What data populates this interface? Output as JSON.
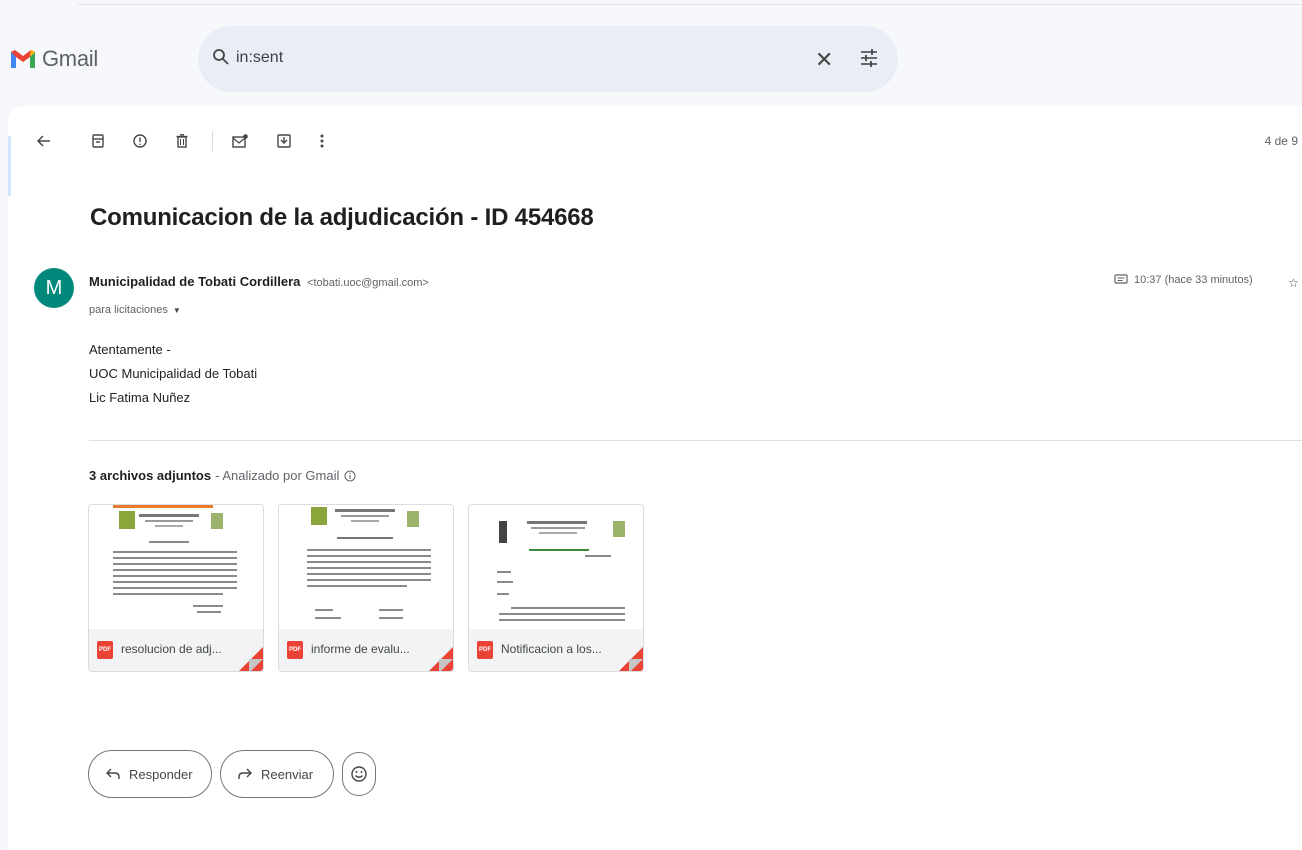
{
  "app": {
    "name": "Gmail"
  },
  "search": {
    "value": "in:sent"
  },
  "toolbar": {
    "page_count": "4 de 9"
  },
  "email": {
    "subject": "Comunicacion de la adjudicación - ID 454668",
    "avatar_letter": "M",
    "sender_name": "Municipalidad de Tobati Cordillera",
    "sender_email": "<tobati.uoc@gmail.com>",
    "recipient": "para licitaciones",
    "time": "10:37 (hace 33 minutos)",
    "body_lines": [
      "Atentamente -",
      "UOC Municipalidad de Tobati",
      "Lic Fatima Nuñez"
    ]
  },
  "attachments": {
    "count_label": "3 archivos adjuntos",
    "scan_label": "- Analizado por Gmail",
    "files": [
      {
        "name": "resolucion de adj...",
        "type": "PDF"
      },
      {
        "name": "informe de evalu...",
        "type": "PDF"
      },
      {
        "name": "Notificacion a los...",
        "type": "PDF"
      }
    ]
  },
  "actions": {
    "reply": "Responder",
    "forward": "Reenviar"
  },
  "colors": {
    "avatar": "#00897b",
    "pdf": "#ea4335",
    "search_bg": "#e9eef6",
    "page_bg": "#f6f8fc"
  },
  "icons": [
    "gmail-logo",
    "search-icon",
    "close-icon",
    "tune-icon",
    "back-arrow-icon",
    "archive-icon",
    "report-spam-icon",
    "delete-icon",
    "mark-unread-icon",
    "move-to-icon",
    "more-vert-icon",
    "chat-icon",
    "info-icon",
    "pdf-icon",
    "reply-icon",
    "forward-icon",
    "emoji-icon"
  ]
}
